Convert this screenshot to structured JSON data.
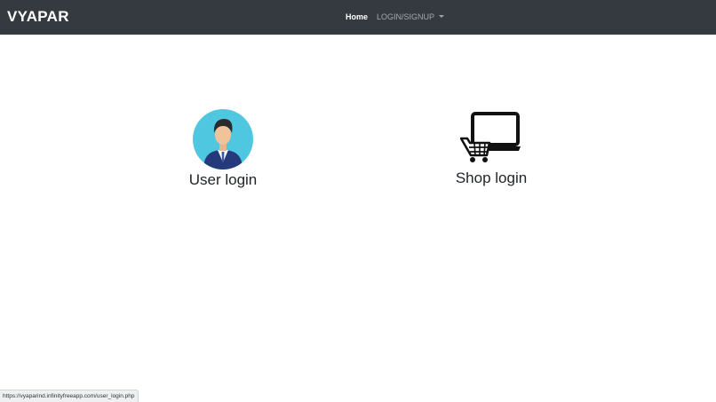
{
  "navbar": {
    "brand": "VYAPAR",
    "links": [
      {
        "label": "Home",
        "active": true
      },
      {
        "label": "LOGIN/SIGNUP",
        "dropdown": true
      }
    ]
  },
  "cards": [
    {
      "label": "User login",
      "icon": "user-avatar-icon"
    },
    {
      "label": "Shop login",
      "icon": "laptop-cart-icon"
    }
  ],
  "status_bar": {
    "url": "https://vyaparind.infinityfreeapp.com/user_login.php"
  },
  "colors": {
    "navbar_bg": "#343a40",
    "avatar_bg": "#4fc7e0",
    "suit": "#253a7a"
  }
}
